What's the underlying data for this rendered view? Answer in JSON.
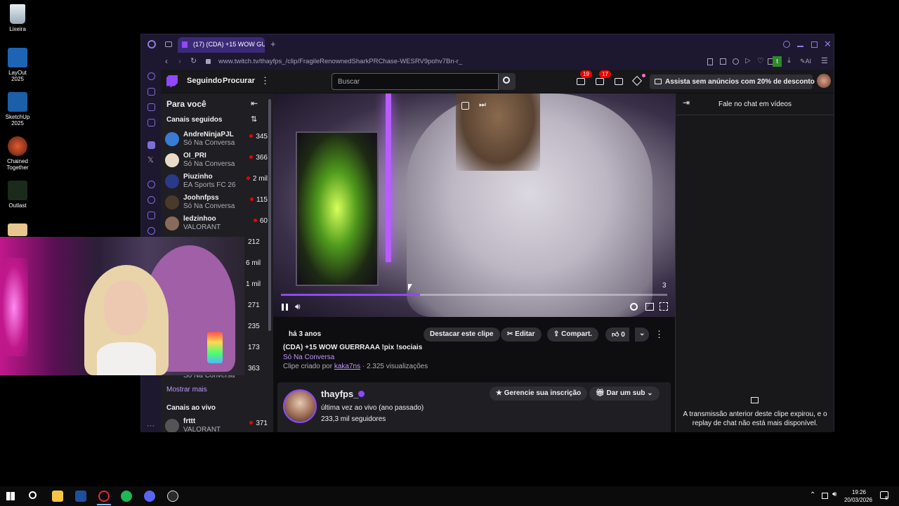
{
  "desktop": {
    "icons": [
      {
        "label": "Lixeira"
      },
      {
        "label": "LayOut 2025"
      },
      {
        "label": "SketchUp 2025"
      },
      {
        "label": "Chained Together"
      },
      {
        "label": "Outlast"
      }
    ]
  },
  "browser": {
    "tab_title": "(17) (CDA) +15 WOW GUERRAAA",
    "url": "www.twitch.tv/thayfps_/clip/FragileRenownedSharkPRChase-WESRV9pohv7Bn-r_",
    "ai_label": "AI",
    "badge_t": "t"
  },
  "twitch": {
    "nav": {
      "following": "Seguindo",
      "browse": "Procurar"
    },
    "search_placeholder": "Buscar",
    "notif_counts": [
      "19",
      "17"
    ],
    "ad_free": "Assista sem anúncios com 20% de desconto",
    "sidebar": {
      "for_you": "Para você",
      "followed_heading": "Canais seguidos",
      "channels": [
        {
          "name": "AndreNinjaPJL",
          "game": "Só Na Conversa",
          "viewers": "345"
        },
        {
          "name": "OI_PRI",
          "game": "Só Na Conversa",
          "viewers": "366"
        },
        {
          "name": "Piuzinho",
          "game": "EA Sports FC 26",
          "viewers": "2 mil"
        },
        {
          "name": "Joohnfpss",
          "game": "Só Na Conversa",
          "viewers": "115"
        },
        {
          "name": "ledzinhoo",
          "game": "VALORANT",
          "viewers": "60"
        }
      ],
      "hidden_viewers": [
        "212",
        "6 mil",
        "1 mil",
        "271",
        "235",
        "173",
        "363"
      ],
      "partial_game": "Só Na Conversa",
      "show_more": "Mostrar mais",
      "live_heading": "Canais ao vivo",
      "live_channel": {
        "name": "frttt",
        "game": "VALORANT",
        "viewers": "371"
      }
    },
    "video": {
      "time_remaining": "3",
      "progress": 0.36
    },
    "clip": {
      "ago": "há 3 anos",
      "title": "(CDA) +15 WOW GUERRAAA !pix !sociais",
      "category": "Só Na Conversa",
      "created_by_prefix": "Clipe criado por",
      "creator": "kaka7ns",
      "views": "2.325 visualizações",
      "highlight": "Destacar este clipe",
      "edit": "Editar",
      "share": "Compart.",
      "likes": "0"
    },
    "channel": {
      "name": "thayfps_",
      "last_live": "última vez ao vivo (ano passado)",
      "followers": "233,3 mil seguidores",
      "manage_sub": "Gerencie sua inscrição",
      "gift_sub": "Dar um sub"
    },
    "chat": {
      "header": "Fale no chat em vídeos",
      "expired": "A transmissão anterior deste clipe expirou, e o replay de chat não está mais disponível."
    }
  },
  "taskbar": {
    "time": "19:26",
    "date": "20/03/2026",
    "notif_count": "8"
  },
  "colors": {
    "twitch_purple": "#9147ff",
    "live_red": "#eb0400",
    "link_purple": "#bf94ff"
  }
}
